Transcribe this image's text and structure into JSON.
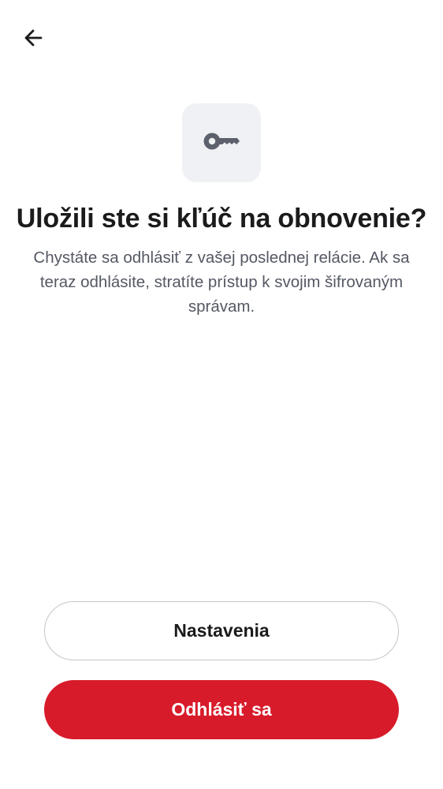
{
  "header": {
    "back_icon": "arrow-left-icon"
  },
  "hero": {
    "icon": "key-icon",
    "title": "Uložili ste si kľúč na obnovenie?",
    "message": "Chystáte sa odhlásiť z vašej poslednej relácie. Ak sa teraz odhlásite, stratíte prístup k svojim šifrovaným správam."
  },
  "actions": {
    "settings_label": "Nastavenia",
    "signout_label": "Odhlásiť sa"
  },
  "colors": {
    "primary": "#d81b2a",
    "icon_tile": "#f0f1f4",
    "icon": "#5c616c",
    "text": "#1b1b1d",
    "secondary_text": "#545863"
  }
}
